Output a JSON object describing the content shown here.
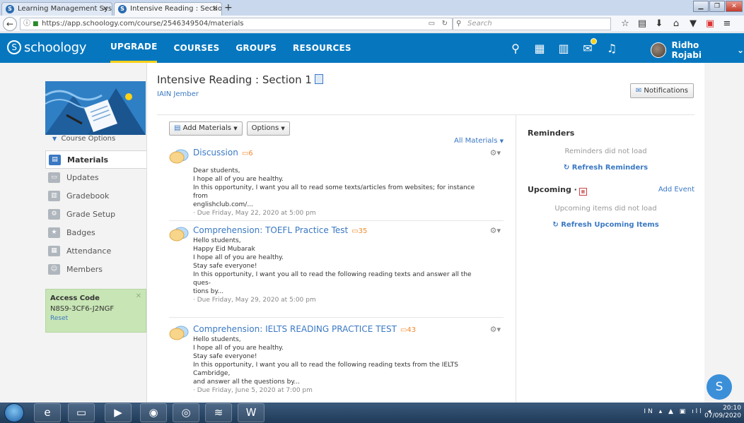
{
  "browser": {
    "tabs": [
      {
        "label": "Learning Management Syste",
        "close": "×"
      },
      {
        "label": "Intensive Reading : Section 1",
        "close": "×"
      }
    ],
    "new_tab": "+",
    "url": "https://app.schoology.com/course/2546349504/materials",
    "search_placeholder": "Search"
  },
  "header": {
    "logo": "schoology",
    "nav": [
      "UPGRADE",
      "COURSES",
      "GROUPS",
      "RESOURCES"
    ],
    "user_name": "Ridho Rojabi"
  },
  "sidebar": {
    "course_options": "Course Options",
    "items": [
      {
        "label": "Materials",
        "icon": "materials-icon"
      },
      {
        "label": "Updates",
        "icon": "updates-icon"
      },
      {
        "label": "Gradebook",
        "icon": "gradebook-icon"
      },
      {
        "label": "Grade Setup",
        "icon": "grade-setup-icon"
      },
      {
        "label": "Badges",
        "icon": "badges-icon"
      },
      {
        "label": "Attendance",
        "icon": "attendance-icon"
      },
      {
        "label": "Members",
        "icon": "members-icon"
      }
    ],
    "access_code": {
      "title": "Access Code",
      "code": "N8S9-3CF6-J2NGF",
      "reset": "Reset"
    }
  },
  "course": {
    "title": "Intensive Reading : Section 1",
    "school": "IAIN Jember",
    "notifications": "Notifications"
  },
  "toolbar": {
    "add_materials": "Add Materials",
    "options": "Options",
    "all_materials": "All Materials"
  },
  "materials": [
    {
      "title": "Discussion",
      "comments": "6",
      "body": [
        "Dear students,",
        "I hope all of you are healthy.",
        "In this opportunity, I want you all to read some texts/articles from websites; for instance from",
        "englishclub.com/..."
      ],
      "due": "· Due Friday, May 22, 2020 at 5:00 pm"
    },
    {
      "title": "Comprehension: TOEFL Practice Test",
      "comments": "35",
      "body": [
        "Hello students,",
        "Happy Eid Mubarak",
        "I hope all of you are healthy.",
        "Stay safe everyone!",
        "In this opportunity, I want you all to read the following reading texts and answer all the ques-",
        "tions by..."
      ],
      "due": "· Due Friday, May 29, 2020 at 5:00 pm"
    },
    {
      "title": "Comprehension: IELTS READING PRACTICE TEST",
      "comments": "43",
      "body": [
        "Hello students,",
        "I hope all of you are healthy.",
        "Stay safe everyone!",
        "In this opportunity, I want you all to read the following reading texts from the IELTS Cambridge,",
        "and answer all the questions by..."
      ],
      "due": "· Due Friday, June 5, 2020 at 7:00 pm"
    }
  ],
  "reminders": {
    "title": "Reminders",
    "message": "Reminders did not load",
    "refresh": "Refresh Reminders"
  },
  "upcoming": {
    "title": "Upcoming ·",
    "add_event": "Add Event",
    "message": "Upcoming items did not load",
    "refresh": "Refresh Upcoming Items"
  },
  "help": "S",
  "taskbar": {
    "language": "IN",
    "time": "20:10",
    "date": "07/09/2020"
  },
  "colors": {
    "brand": "#0677bf",
    "accent": "#fcd116",
    "link": "#3a78c3",
    "comment": "#f28a2e",
    "access_bg": "#c8e5b5"
  }
}
